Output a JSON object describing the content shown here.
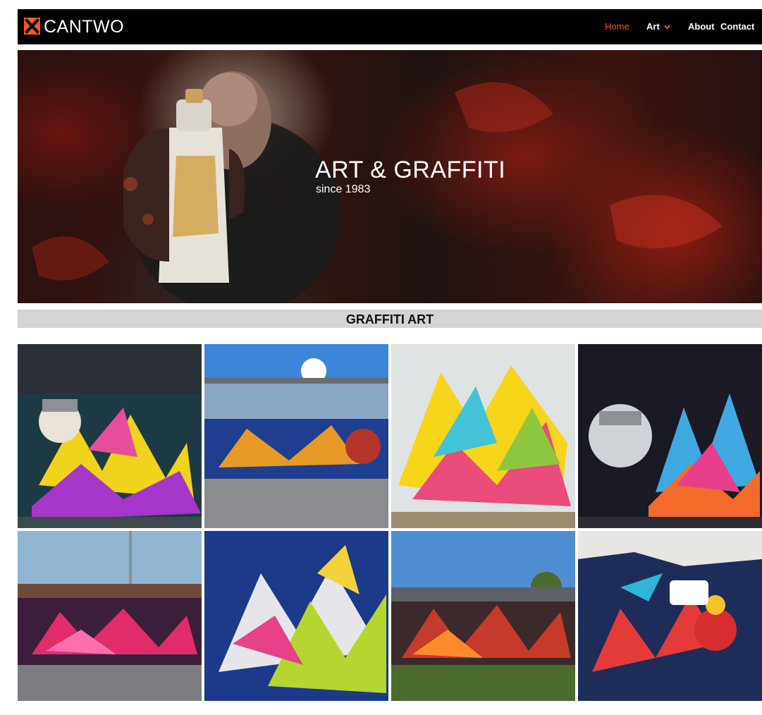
{
  "brand": {
    "name": "CANTWO",
    "accent": "#f05a1a"
  },
  "nav": {
    "items": [
      {
        "label": "Home",
        "active": true
      },
      {
        "label": "Art",
        "has_dropdown": true
      },
      {
        "label": "About"
      },
      {
        "label": "Contact"
      }
    ]
  },
  "hero": {
    "title": "ART & GRAFFITI",
    "subtitle": "since 1983"
  },
  "section": {
    "title": "GRAFFITI ART"
  },
  "gallery": {
    "items": [
      {
        "icon": "graffiti-image"
      },
      {
        "icon": "graffiti-image"
      },
      {
        "icon": "graffiti-image"
      },
      {
        "icon": "graffiti-image"
      },
      {
        "icon": "graffiti-image"
      },
      {
        "icon": "graffiti-image"
      },
      {
        "icon": "graffiti-image"
      },
      {
        "icon": "graffiti-image"
      }
    ]
  }
}
